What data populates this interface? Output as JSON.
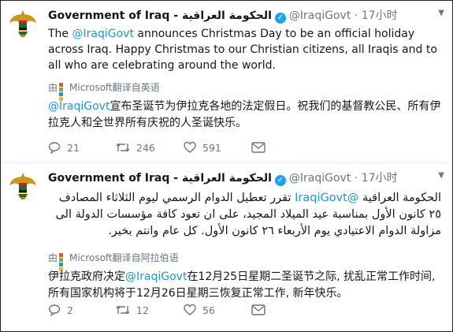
{
  "tweets": [
    {
      "name": "Government of Iraq - الحكومة العراقية",
      "handle": "@IraqiGovt",
      "separator": "·",
      "time": "17小时",
      "text_before": "The ",
      "text_mention": "@IraqiGovt",
      "text_after": " announces Christmas Day to be an official holiday across Iraq. Happy Christmas to our Christian citizens, all Iraqis and to all who are celebrating around the world.",
      "translation_prefix": "由",
      "translation_brand": "Microsoft",
      "translation_suffix": "翻译自英语",
      "translated_mention": "@IraqiGovt",
      "translated_rest": "宣布圣诞节为伊拉克各地的法定假日。祝我们的基督教公民、所有伊拉克人和全世界所有庆祝的人圣诞快乐。",
      "replies": "21",
      "retweets": "246",
      "likes": "591"
    },
    {
      "name": "Government of Iraq - الحكومة العراقية",
      "handle": "@IraqiGovt",
      "separator": "·",
      "time": "17小时",
      "text_before": "الحكومة العراقية ",
      "text_mention": "@IraqiGovt",
      "text_after": " تقرر تعطيل الدوام الرسمي ليوم الثلاثاء المصادف ٢٥ كانون الأول بمناسبة عيد الميلاد المجيد، على ان تعود كافة مؤسسات الدولة الى مزاولة الدوام الاعتيادي يوم الأربعاء ٢٦ كانون الأول. كل عام وانتم بخير.",
      "translation_prefix": "由",
      "translation_brand": "Microsoft",
      "translation_suffix": "翻译自阿拉伯语",
      "translated_before": "伊拉克政府决定",
      "translated_mention": "@IraqiGovt",
      "translated_rest": "在12月25日星期二圣诞节之际, 扰乱正常工作时间, 所有国家机构将于12月26日星期三恢复正常工作, 新年快乐。",
      "replies": "2",
      "retweets": "12",
      "likes": "56"
    }
  ],
  "colors": {
    "link": "#1b95e0",
    "muted": "#657786",
    "verified": "#1da1f2"
  }
}
